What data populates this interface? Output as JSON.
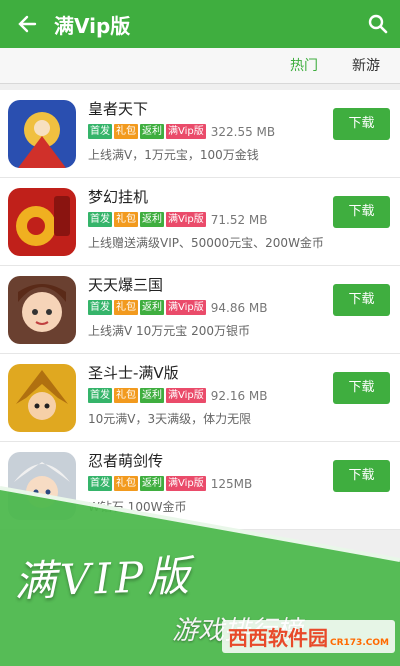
{
  "appbar": {
    "title": "满Vip版"
  },
  "tabs": {
    "hot": "热门",
    "new": "新游"
  },
  "colors": {
    "primary": "#3fae3f",
    "tag_first": "#35b46a",
    "tag_gift": "#f29a1e",
    "tag_rebate": "#3fae3f",
    "tag_vip": "#ea4b6a"
  },
  "icons": {
    "back": "arrow-left-icon",
    "search": "search-icon"
  },
  "items": [
    {
      "name": "皇者天下",
      "tags": [
        "首发",
        "礼包",
        "返利",
        "满Vip版"
      ],
      "size": "322.55 MB",
      "desc": "上线满V，1万元宝，100万金钱",
      "button": "下载"
    },
    {
      "name": "梦幻挂机",
      "tags": [
        "首发",
        "礼包",
        "返利",
        "满Vip版"
      ],
      "size": "71.52 MB",
      "desc": "上线赠送满级VIP、50000元宝、200W金币",
      "button": "下载"
    },
    {
      "name": "天天爆三国",
      "tags": [
        "首发",
        "礼包",
        "返利",
        "满Vip版"
      ],
      "size": "94.86 MB",
      "desc": "上线满V 10万元宝 200万银币",
      "button": "下载"
    },
    {
      "name": "圣斗士-满V版",
      "tags": [
        "首发",
        "礼包",
        "返利",
        "满Vip版"
      ],
      "size": "92.16 MB",
      "desc": "10元满V，3天满级，体力无限",
      "button": "下载"
    },
    {
      "name": "忍者萌剑传",
      "tags": [
        "首发",
        "礼包",
        "返利",
        "满Vip版"
      ],
      "size": "125MB",
      "desc": "W钻石 100W金币",
      "button": "下载"
    }
  ],
  "banner": {
    "line1": "满VIP版",
    "line2": "游戏排行榜",
    "watermark": "西西软件园",
    "watermark_sub": "CR173.COM"
  }
}
